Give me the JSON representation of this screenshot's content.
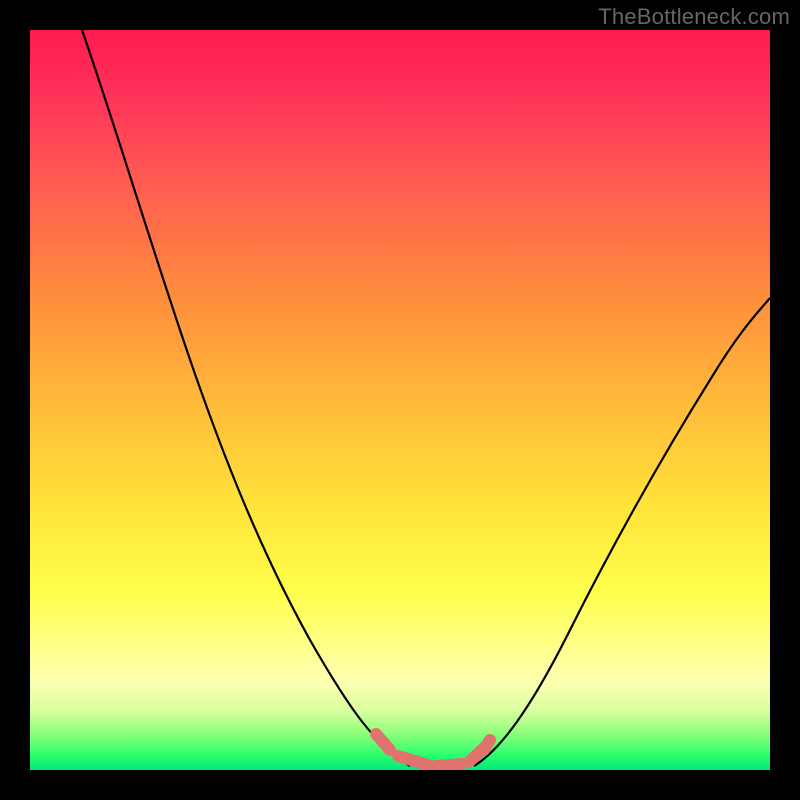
{
  "watermark": "TheBottleneck.com",
  "colors": {
    "background": "#000000",
    "curve": "#000000",
    "highlight": "#e1736e"
  },
  "chart_data": {
    "type": "line",
    "title": "",
    "xlabel": "",
    "ylabel": "",
    "xlim": [
      0,
      100
    ],
    "ylim": [
      0,
      100
    ],
    "grid": false,
    "legend": false,
    "series": [
      {
        "name": "left-curve",
        "x": [
          7,
          12,
          18,
          25,
          32,
          38,
          43.5,
          47.5,
          51.5
        ],
        "y": [
          100,
          86,
          70,
          52,
          35,
          21,
          9.5,
          3.5,
          0.5
        ]
      },
      {
        "name": "right-curve",
        "x": [
          60,
          63,
          67,
          72,
          78,
          85,
          92,
          100
        ],
        "y": [
          0.5,
          4,
          10,
          19,
          30,
          42,
          53,
          64
        ]
      },
      {
        "name": "bottom-highlight",
        "x": [
          47,
          50,
          54,
          58,
          61.5
        ],
        "y": [
          4,
          1.5,
          0.5,
          0.8,
          3.5
        ]
      }
    ]
  }
}
